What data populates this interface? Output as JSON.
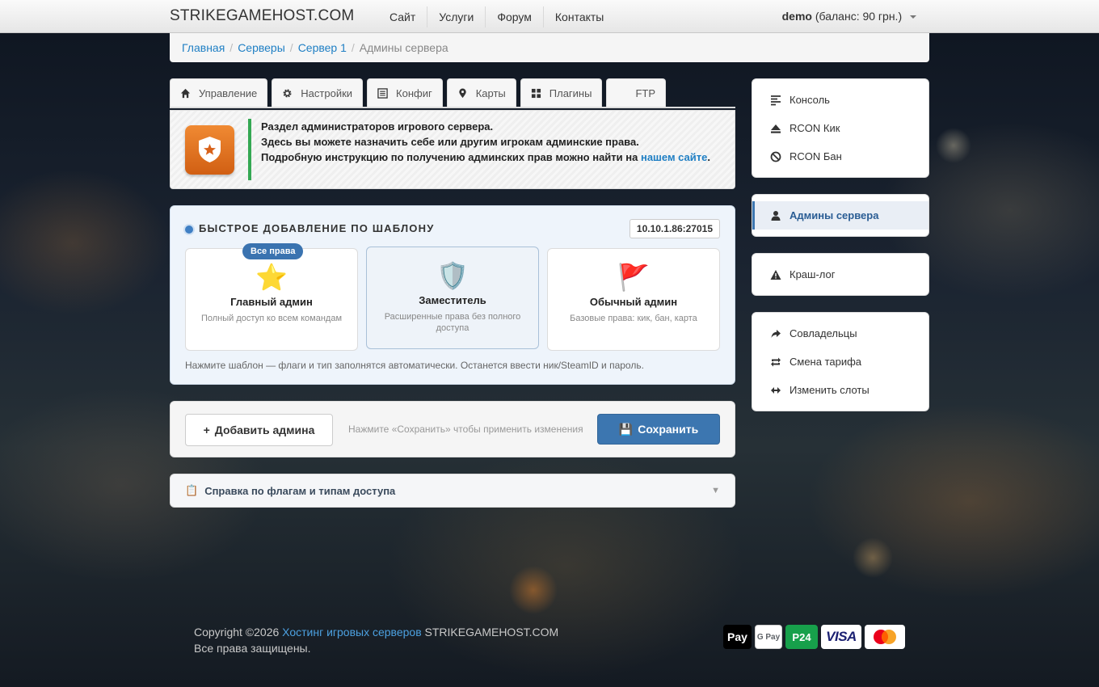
{
  "header": {
    "brand": "STRIKEGAMEHOST.COM",
    "nav": [
      "Сайт",
      "Услуги",
      "Форум",
      "Контакты"
    ],
    "user_name": "demo",
    "user_balance": "(баланс: 90 грн.)"
  },
  "breadcrumb": {
    "items": [
      "Главная",
      "Серверы",
      "Сервер 1"
    ],
    "current": "Админы сервера"
  },
  "tabs": [
    {
      "label": "Управление",
      "icon": "home-icon"
    },
    {
      "label": "Настройки",
      "icon": "gear-icon"
    },
    {
      "label": "Конфиг",
      "icon": "list-icon"
    },
    {
      "label": "Карты",
      "icon": "map-marker-icon"
    },
    {
      "label": "Плагины",
      "icon": "grid-icon"
    },
    {
      "label": "FTP",
      "icon": "ftp-icon"
    }
  ],
  "info": {
    "line1": "Раздел администраторов игрового сервера.",
    "line2": "Здесь вы можете назначить себе или другим игрокам админские права.",
    "line3": "Подробную инструкцию по получению админских прав можно найти на",
    "link": "нашем сайте",
    "dot": "."
  },
  "templates": {
    "title": "БЫСТРОЕ ДОБАВЛЕНИЕ ПО ШАБЛОНУ",
    "server_ip": "10.10.1.86:27015",
    "cards": [
      {
        "emoji": "⭐",
        "name": "Главный админ",
        "desc": "Полный доступ ко всем командам",
        "badge": "Все права"
      },
      {
        "emoji": "🛡️",
        "name": "Заместитель",
        "desc": "Расширенные права без полного доступа"
      },
      {
        "emoji": "🚩",
        "name": "Обычный админ",
        "desc": "Базовые права: кик, бан, карта"
      }
    ],
    "hint": "Нажмите шаблон — флаги и тип заполнятся автоматически. Останется ввести ник/SteamID и пароль."
  },
  "actions": {
    "add_label": "Добавить админа",
    "add_plus": "+",
    "hint": "Нажмите «Сохранить» чтобы применить изменения",
    "save_icon": "💾",
    "save_label": "Сохранить"
  },
  "help": {
    "icon": "📋",
    "label": "Справка по флагам и типам доступа",
    "chevron": "▼"
  },
  "sidebar": {
    "group1": [
      {
        "label": "Консоль",
        "icon": "console-icon"
      },
      {
        "label": "RCON Кик",
        "icon": "eject-icon"
      },
      {
        "label": "RCON Бан",
        "icon": "ban-icon"
      }
    ],
    "group2": [
      {
        "label": "Админы сервера",
        "icon": "user-icon",
        "active": true
      }
    ],
    "group3": [
      {
        "label": "Краш-лог",
        "icon": "warning-icon"
      }
    ],
    "group4": [
      {
        "label": "Совладельцы",
        "icon": "share-icon"
      },
      {
        "label": "Смена тарифа",
        "icon": "retweet-icon"
      },
      {
        "label": "Изменить слоты",
        "icon": "resize-icon"
      }
    ]
  },
  "footer": {
    "copyright": "Copyright ©2026",
    "link": "Хостинг игровых серверов",
    "site": "STRIKEGAMEHOST.COM",
    "rights": "Все права защищены.",
    "payments": [
      "Pay",
      "G Pay",
      "P24",
      "VISA"
    ]
  },
  "colors": {
    "accent": "#3c76b0",
    "link": "#1f7fc4",
    "info_bar": "#34a853",
    "badge_orange": "#e8731f"
  }
}
